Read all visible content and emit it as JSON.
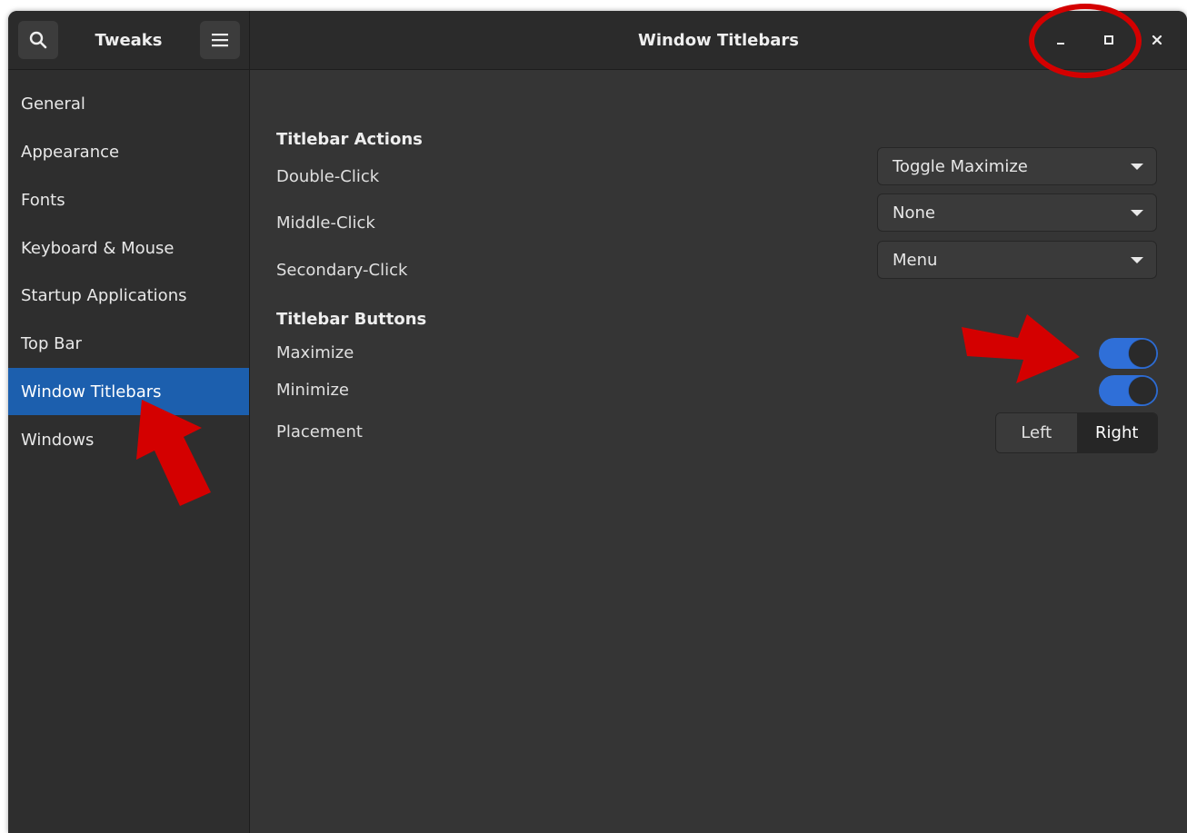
{
  "header": {
    "app_title": "Tweaks",
    "page_title": "Window Titlebars",
    "search_icon": "search-icon",
    "menu_icon": "hamburger-menu-icon"
  },
  "window_controls": {
    "minimize_icon": "minimize-icon",
    "maximize_icon": "maximize-icon",
    "close_icon": "close-icon"
  },
  "sidebar": {
    "items": [
      {
        "label": "General"
      },
      {
        "label": "Appearance"
      },
      {
        "label": "Fonts"
      },
      {
        "label": "Keyboard & Mouse"
      },
      {
        "label": "Startup Applications"
      },
      {
        "label": "Top Bar"
      },
      {
        "label": "Window Titlebars"
      },
      {
        "label": "Windows"
      }
    ],
    "active_index": 6
  },
  "content": {
    "titlebar_actions": {
      "title": "Titlebar Actions",
      "double_click": {
        "label": "Double-Click",
        "value": "Toggle Maximize"
      },
      "middle_click": {
        "label": "Middle-Click",
        "value": "None"
      },
      "secondary_click": {
        "label": "Secondary-Click",
        "value": "Menu"
      }
    },
    "titlebar_buttons": {
      "title": "Titlebar Buttons",
      "maximize": {
        "label": "Maximize",
        "enabled": true
      },
      "minimize": {
        "label": "Minimize",
        "enabled": true
      },
      "placement": {
        "label": "Placement",
        "options": [
          "Left",
          "Right"
        ],
        "selected": "Right"
      }
    }
  },
  "colors": {
    "accent": "#1c5fae",
    "switch_on": "#2f6fd8",
    "annotation": "#d40000"
  }
}
